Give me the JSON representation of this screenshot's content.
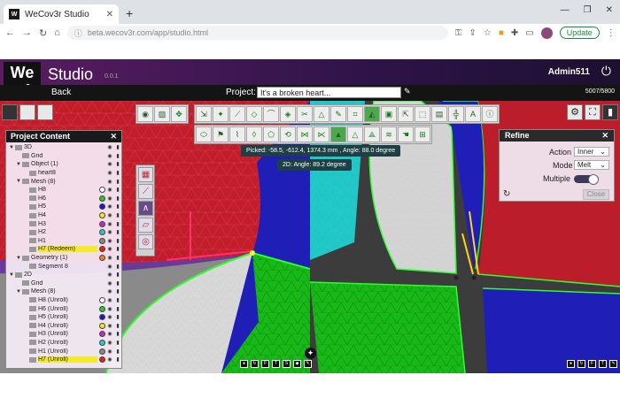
{
  "browser": {
    "tab_title": "WeCov3r Studio",
    "url": "beta.wecov3r.com/app/studio.html",
    "update_label": "Update"
  },
  "app": {
    "logo_line1": "We",
    "logo_line2": "cov3r",
    "title": "Studio",
    "version": "0.0.1",
    "user": "Admin511",
    "back_label": "Back",
    "project_label": "Project:",
    "project_name": "It's a broken heart...",
    "counter": "5007/5800"
  },
  "tooltips": {
    "picked": "Picked: -58.5, -612.4, 1374.3 mm , Angle: 88.0 degree",
    "angle2d": "2D: Angle: 89.2 degree"
  },
  "project_panel": {
    "title": "Project Content",
    "rows": [
      {
        "level": 0,
        "toggle": "▼",
        "name": "3D",
        "swatch": "",
        "hl": false
      },
      {
        "level": 1,
        "toggle": "",
        "name": "Grid",
        "swatch": "",
        "hl": false
      },
      {
        "level": 1,
        "toggle": "▼",
        "name": "Object (1)",
        "swatch": "",
        "hl": false
      },
      {
        "level": 2,
        "toggle": "",
        "name": "heart8",
        "swatch": "",
        "hl": false
      },
      {
        "level": 1,
        "toggle": "▼",
        "name": "Mesh (8)",
        "swatch": "",
        "hl": false
      },
      {
        "level": 2,
        "toggle": "",
        "name": "H8",
        "swatch": "#ffffff",
        "hl": false
      },
      {
        "level": 2,
        "toggle": "",
        "name": "H6",
        "swatch": "#22cc22",
        "hl": false
      },
      {
        "level": 2,
        "toggle": "",
        "name": "H5",
        "swatch": "#1a1acc",
        "hl": false
      },
      {
        "level": 2,
        "toggle": "",
        "name": "H4",
        "swatch": "#f5e61a",
        "hl": false
      },
      {
        "level": 2,
        "toggle": "",
        "name": "H3",
        "swatch": "#cc22cc",
        "hl": false
      },
      {
        "level": 2,
        "toggle": "",
        "name": "H2",
        "swatch": "#22cccc",
        "hl": false
      },
      {
        "level": 2,
        "toggle": "",
        "name": "H1",
        "swatch": "#888888",
        "hl": false
      },
      {
        "level": 2,
        "toggle": "",
        "name": "H7 (Redeem)",
        "swatch": "#e02020",
        "hl": true
      },
      {
        "level": 1,
        "toggle": "▼",
        "name": "Geometry (1)",
        "swatch": "#f08020",
        "hl": false
      },
      {
        "level": 2,
        "toggle": "",
        "name": "Segment 8",
        "swatch": "",
        "hl": false
      },
      {
        "level": 0,
        "toggle": "▼",
        "name": "2D",
        "swatch": "",
        "hl": false
      },
      {
        "level": 1,
        "toggle": "",
        "name": "Grid",
        "swatch": "",
        "hl": false
      },
      {
        "level": 1,
        "toggle": "▼",
        "name": "Mesh (8)",
        "swatch": "",
        "hl": false
      },
      {
        "level": 2,
        "toggle": "",
        "name": "H8 (Unroll)",
        "swatch": "#ffffff",
        "hl": false
      },
      {
        "level": 2,
        "toggle": "",
        "name": "H6 (Unroll)",
        "swatch": "#22cc22",
        "hl": false
      },
      {
        "level": 2,
        "toggle": "",
        "name": "H5 (Unroll)",
        "swatch": "#1a1acc",
        "hl": false
      },
      {
        "level": 2,
        "toggle": "",
        "name": "H4 (Unroll)",
        "swatch": "#f5e61a",
        "hl": false
      },
      {
        "level": 2,
        "toggle": "",
        "name": "H3 (Unroll)",
        "swatch": "#cc22cc",
        "hl": false
      },
      {
        "level": 2,
        "toggle": "",
        "name": "H2 (Unroll)",
        "swatch": "#22cccc",
        "hl": false
      },
      {
        "level": 2,
        "toggle": "",
        "name": "H1 (Unroll)",
        "swatch": "#888888",
        "hl": false
      },
      {
        "level": 2,
        "toggle": "",
        "name": "H7 (Unroll)",
        "swatch": "#e02020",
        "hl": true
      }
    ]
  },
  "refine_panel": {
    "title": "Refine",
    "action_label": "Action",
    "action_value": "Inner",
    "mode_label": "Mode",
    "mode_value": "Melt",
    "multiple_label": "Multiple",
    "multiple_on": true,
    "close_label": "Close"
  }
}
